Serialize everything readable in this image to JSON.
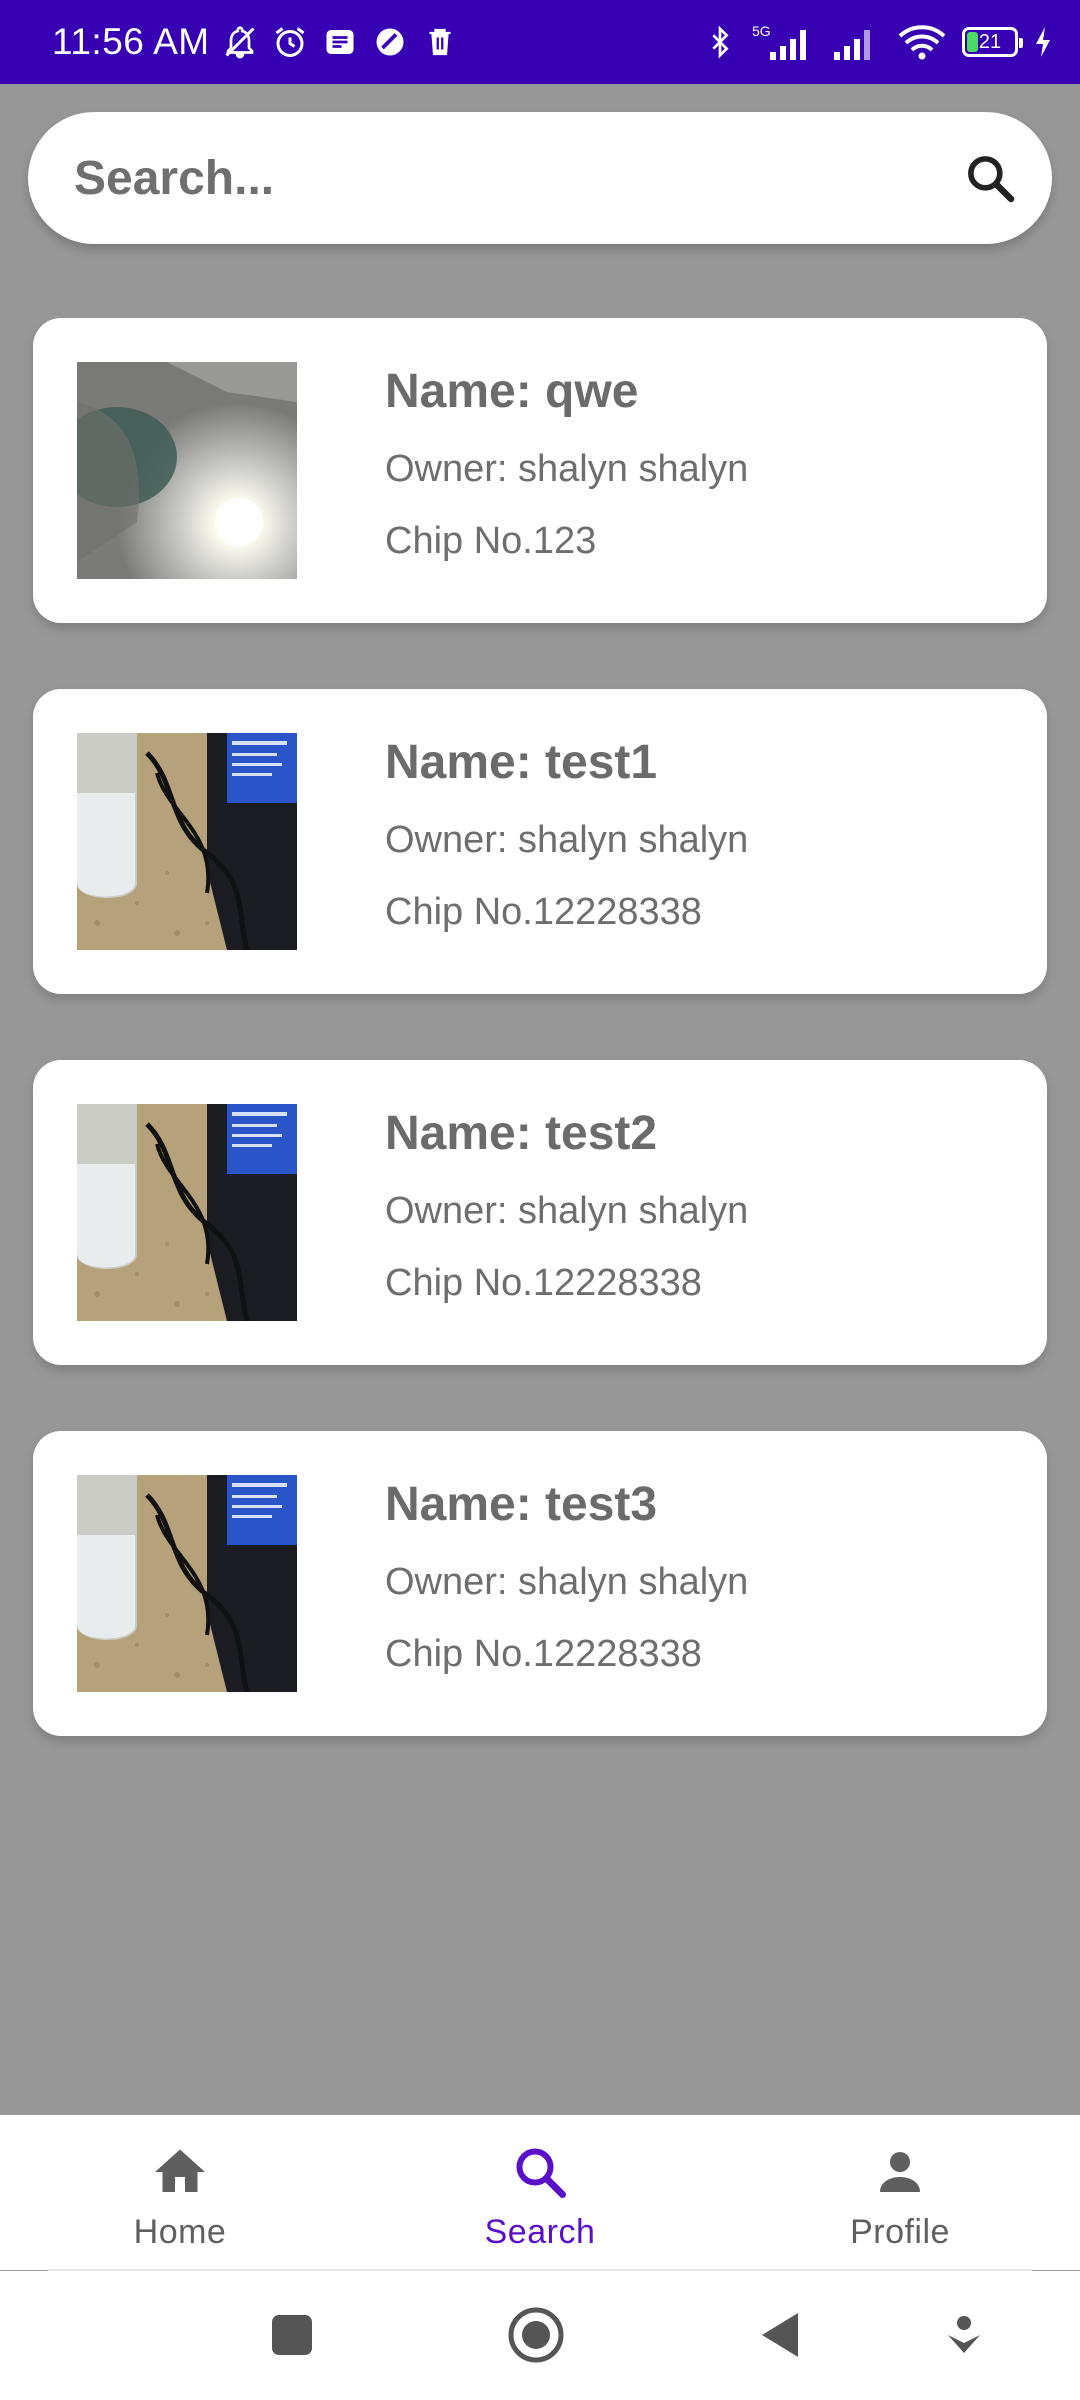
{
  "status_bar": {
    "time": "11:56 AM",
    "left_icons": [
      "muted-notification-icon",
      "alarm-icon",
      "message-icon",
      "data-saver-icon",
      "trash-icon"
    ],
    "right_icons": [
      "bluetooth-icon",
      "signal-5g-icon",
      "signal-icon",
      "wifi-icon",
      "battery-icon",
      "charging-icon"
    ],
    "network_label": "5G",
    "battery_level": "21"
  },
  "search": {
    "placeholder": "Search...",
    "value": ""
  },
  "pets": [
    {
      "name": "Name: qwe",
      "owner": "Owner: shalyn shalyn",
      "chip": "Chip No.123",
      "photo": "photo-lamp-light"
    },
    {
      "name": "Name: test1",
      "owner": "Owner: shalyn shalyn",
      "chip": "Chip No.12228338",
      "photo": "photo-desk-glass-laptop"
    },
    {
      "name": "Name: test2",
      "owner": "Owner: shalyn shalyn",
      "chip": "Chip No.12228338",
      "photo": "photo-desk-glass-laptop"
    },
    {
      "name": "Name: test3",
      "owner": "Owner: shalyn shalyn",
      "chip": "Chip No.12228338",
      "photo": "photo-desk-glass-laptop"
    }
  ],
  "bottom_nav": {
    "items": [
      {
        "label": "Home",
        "icon": "home-icon",
        "active": false
      },
      {
        "label": "Search",
        "icon": "search-icon",
        "active": true
      },
      {
        "label": "Profile",
        "icon": "person-icon",
        "active": false
      }
    ],
    "active_color": "#5a10c8",
    "inactive_color": "#5f5f5f"
  },
  "system_nav": [
    "recents-button",
    "home-button",
    "back-button",
    "assist-button"
  ],
  "colors": {
    "status_bar": "#3700b3",
    "background": "#979797",
    "card": "#ffffff",
    "text": "#6e6e6e"
  }
}
